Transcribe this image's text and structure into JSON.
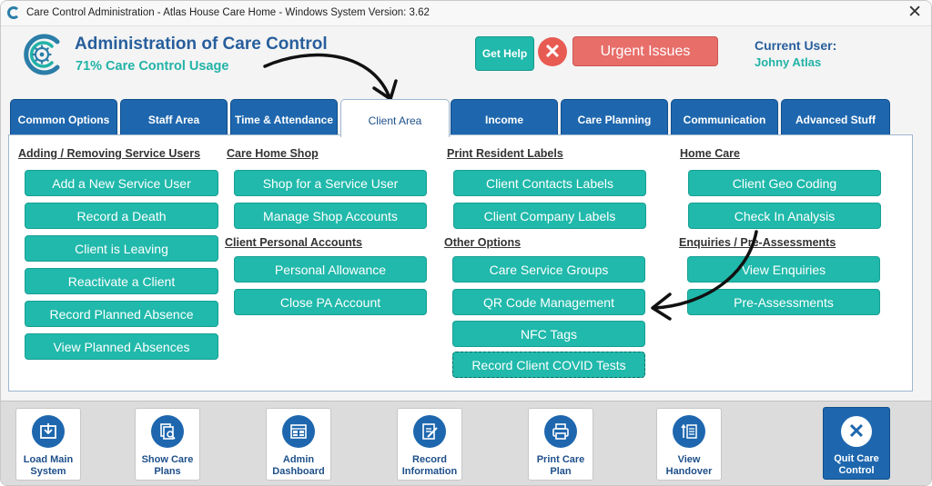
{
  "window": {
    "title": "Care Control Administration - Atlas House Care Home - Windows System Version: 3.62",
    "close_glyph": "✕"
  },
  "header": {
    "app_title": "Administration of Care Control",
    "usage": "71% Care Control Usage",
    "help_label": "Get Help",
    "urgent_icon_glyph": "✕",
    "urgent_label": "Urgent Issues",
    "user_label": "Current User:",
    "user_name": "Johny Atlas",
    "logo_icon": "gear-icon"
  },
  "tabs": [
    {
      "label": "Common Options"
    },
    {
      "label": "Staff Area"
    },
    {
      "label": "Time & Attendance"
    },
    {
      "label": "Client Area",
      "active": true
    },
    {
      "label": "Income"
    },
    {
      "label": "Care Planning"
    },
    {
      "label": "Communication"
    },
    {
      "label": "Advanced Stuff"
    }
  ],
  "sections": {
    "adding_removing": {
      "heading": "Adding / Removing Service Users",
      "buttons": [
        "Add a New Service User",
        "Record a Death",
        "Client is Leaving",
        "Reactivate a Client",
        "Record Planned Absence",
        "View Planned Absences"
      ]
    },
    "shop": {
      "heading": "Care Home Shop",
      "buttons": [
        "Shop for a Service User",
        "Manage Shop Accounts"
      ]
    },
    "personal_accounts": {
      "heading": "Client Personal Accounts",
      "buttons": [
        "Personal Allowance",
        "Close PA Account"
      ]
    },
    "labels": {
      "heading": "Print Resident Labels",
      "buttons": [
        "Client Contacts Labels",
        "Client Company Labels"
      ]
    },
    "other": {
      "heading": "Other Options",
      "buttons": [
        "Care Service Groups",
        "QR Code Management",
        "NFC Tags",
        "Record Client COVID Tests"
      ]
    },
    "home_care": {
      "heading": "Home Care",
      "buttons": [
        "Client Geo Coding",
        "Check In Analysis"
      ]
    },
    "enquiries": {
      "heading": "Enquiries / Pre-Assessments",
      "buttons": [
        "View Enquiries",
        "Pre-Assessments"
      ]
    }
  },
  "bottom": [
    {
      "label": "Load Main System",
      "icon": "download-box-icon"
    },
    {
      "label": "Show Care Plans",
      "icon": "documents-search-icon"
    },
    {
      "label": "Admin Dashboard",
      "icon": "dashboard-icon"
    },
    {
      "label": "Record Information",
      "icon": "edit-document-icon"
    },
    {
      "label": "Print Care Plan",
      "icon": "printer-icon"
    },
    {
      "label": "View Handover",
      "icon": "sort-list-icon"
    },
    {
      "label": "Quit Care Control",
      "icon": "close-icon",
      "glyph": "✕"
    }
  ],
  "colors": {
    "teal": "#20b9ab",
    "blue": "#1e67ae",
    "urgent": "#e86e6a",
    "title_blue": "#275e9c"
  }
}
